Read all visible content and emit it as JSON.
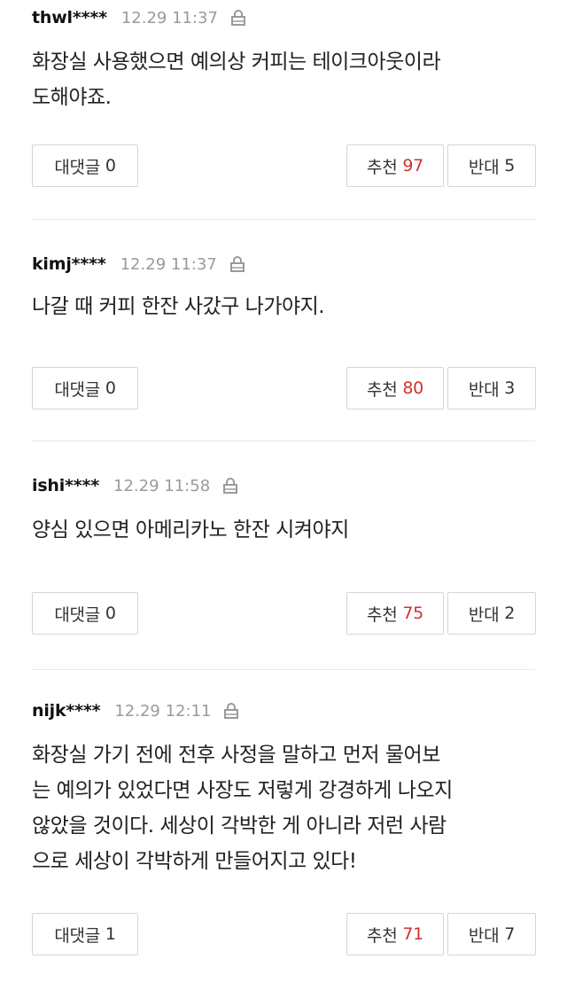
{
  "comments": [
    {
      "author": "thwl****",
      "time": "12.29 11:37",
      "lines": [
        "화장실 사용했으면 예의상 커피는 테이크아웃이라",
        "도해야죠."
      ],
      "reply_label": "대댓글",
      "reply_count": "0",
      "up_label": "추천",
      "up_count": "97",
      "down_label": "반대",
      "down_count": "5"
    },
    {
      "author": "kimj****",
      "time": "12.29 11:37",
      "lines": [
        "나갈 때 커피 한잔 사갔구 나가야지."
      ],
      "reply_label": "대댓글",
      "reply_count": "0",
      "up_label": "추천",
      "up_count": "80",
      "down_label": "반대",
      "down_count": "3"
    },
    {
      "author": "ishi****",
      "time": "12.29 11:58",
      "lines": [
        "양심 있으면 아메리카노 한잔 시켜야지"
      ],
      "reply_label": "대댓글",
      "reply_count": "0",
      "up_label": "추천",
      "up_count": "75",
      "down_label": "반대",
      "down_count": "2"
    },
    {
      "author": "nijk****",
      "time": "12.29 12:11",
      "lines": [
        "화장실 가기 전에 전후 사정을 말하고 먼저 물어보",
        "는 예의가 있었다면 사장도 저렇게 강경하게 나오지",
        "않았을 것이다. 세상이 각박한 게 아니라 저런 사람",
        "으로 세상이 각박하게 만들어지고 있다!"
      ],
      "reply_label": "대댓글",
      "reply_count": "1",
      "up_label": "추천",
      "up_count": "71",
      "down_label": "반대",
      "down_count": "7"
    }
  ],
  "colors": {
    "up_count": "#d0322c",
    "time": "#9a9a9a",
    "border": "#d6d6d6"
  },
  "icons": {
    "meta": "lock-icon"
  }
}
